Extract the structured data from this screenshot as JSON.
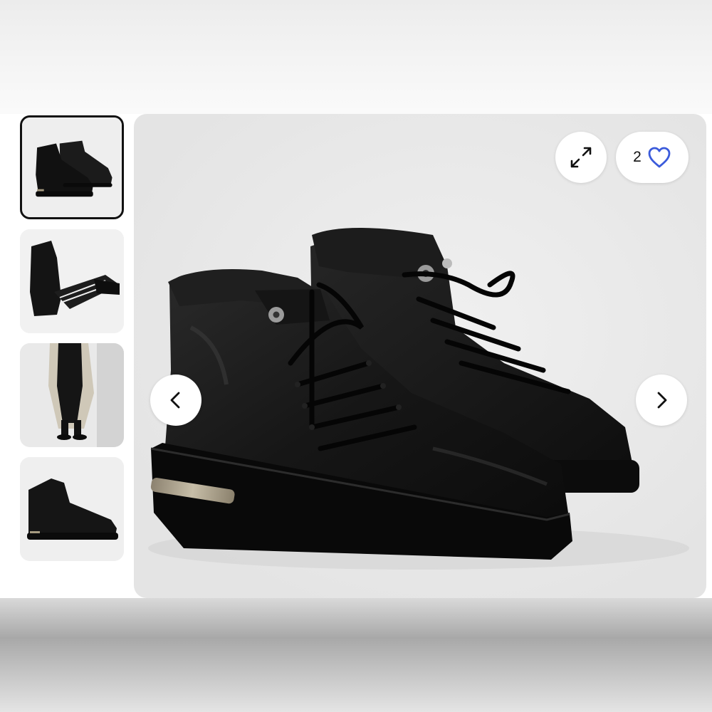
{
  "listing": {
    "likes": "2",
    "selected_image": 1,
    "image_count": 4
  },
  "icons": {
    "expand": "expand-arrows-icon",
    "like": "heart-outline-icon",
    "prev": "chevron-left-icon",
    "next": "chevron-right-icon"
  },
  "colors": {
    "heart": "#3b5bdb",
    "selected_border": "#111111",
    "button_bg": "#ffffff"
  }
}
